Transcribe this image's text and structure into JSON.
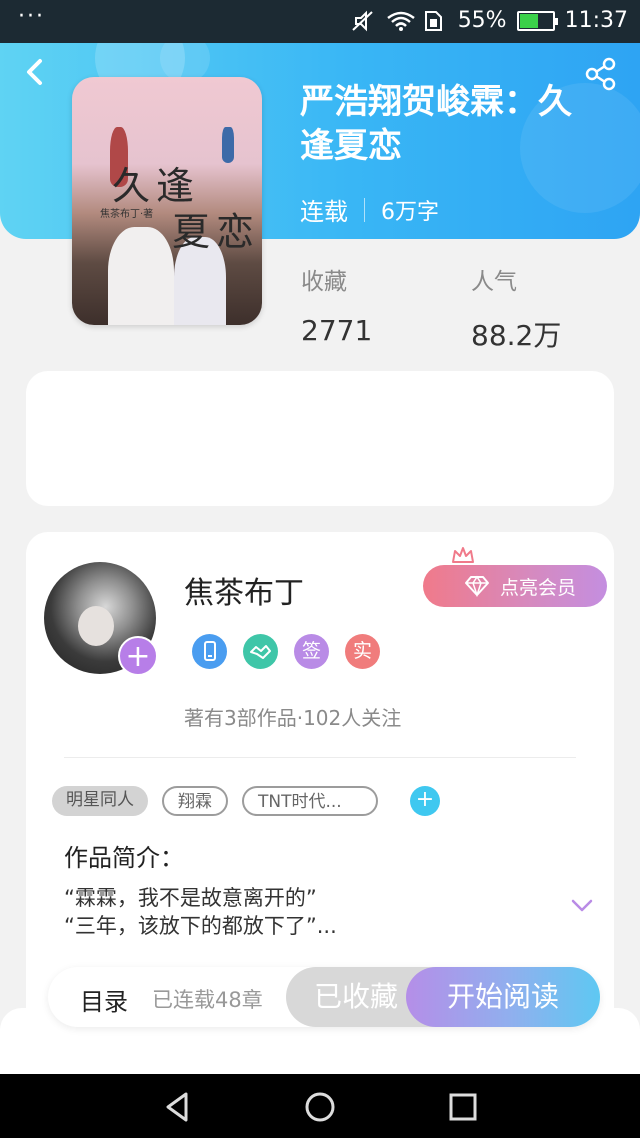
{
  "status_bar": {
    "more": "···",
    "battery_percent": "55%",
    "battery_level": 0.55,
    "time": "11:37",
    "icons": [
      "mute-icon",
      "wifi-icon",
      "sim-icon",
      "battery-icon"
    ]
  },
  "header": {
    "back_icon": "chevron-left-icon",
    "share_icon": "share-icon",
    "title": "严浩翔贺峻霖：久逢夏恋",
    "status": "连载",
    "word_count": "6万字"
  },
  "cover": {
    "title_line1": "久逢",
    "title_line2": "夏恋",
    "author_small": "焦茶布丁·著"
  },
  "stats": {
    "favorites_label": "收藏",
    "favorites_value": "2771",
    "popularity_label": "人气",
    "popularity_value": "88.2万"
  },
  "author": {
    "name": "焦茶布丁",
    "follow_icon": "plus-icon",
    "vip_label": "点亮会员",
    "vip_icon": "diamond-icon",
    "crown_icon": "crown-icon",
    "badges": [
      {
        "icon": "phone-badge-icon",
        "text": "",
        "color": "#4a9df0"
      },
      {
        "icon": "handshake-badge-icon",
        "text": "",
        "color": "#3fc6a8"
      },
      {
        "icon": "sign-badge-icon",
        "text": "签",
        "color": "#b98be6"
      },
      {
        "icon": "real-badge-icon",
        "text": "实",
        "color": "#f07c7c"
      }
    ],
    "stats_text": "著有3部作品·102人关注"
  },
  "tags": {
    "items": [
      "明星同人",
      "翔霖",
      "TNT时代..."
    ],
    "add_icon": "plus-icon"
  },
  "intro": {
    "heading": "作品简介：",
    "line1": "“霖霖，我不是故意离开的”",
    "line2": "“三年，该放下的都放下了”...",
    "expand_icon": "chevron-down-icon"
  },
  "actions": {
    "toc": "目录",
    "serial_status": "已连载48章",
    "favorited": "已收藏",
    "start_reading": "开始阅读"
  },
  "nav": {
    "back_icon": "triangle-back-icon",
    "home_icon": "circle-home-icon",
    "recent_icon": "square-recent-icon"
  },
  "colors": {
    "header_gradient": [
      "#5fd3f3",
      "#2ea4f3"
    ],
    "vip_gradient": [
      "#f07a8a",
      "#c48ee0"
    ],
    "read_gradient": [
      "#b58ee8",
      "#5ec8f2"
    ]
  }
}
